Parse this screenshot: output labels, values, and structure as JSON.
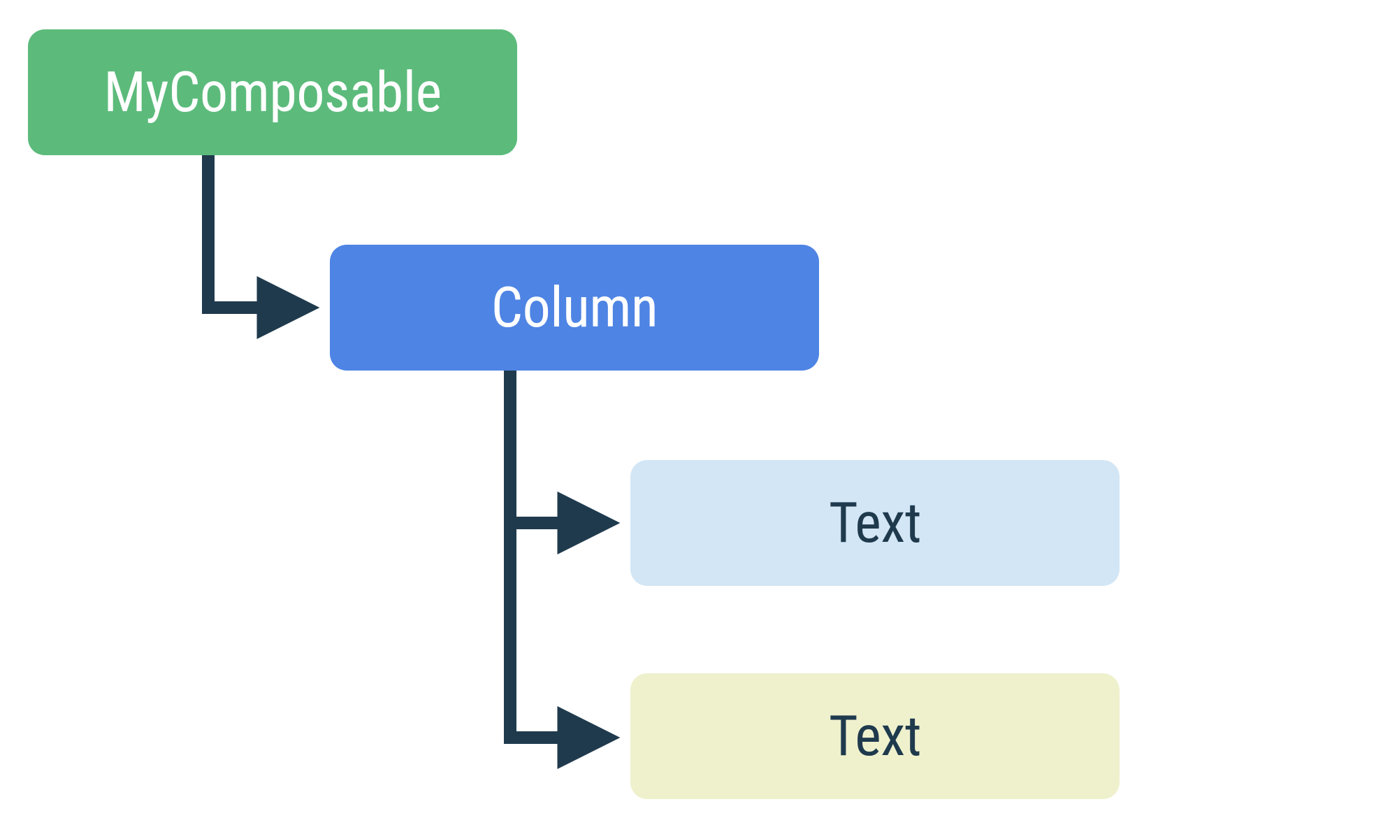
{
  "diagram": {
    "nodes": {
      "root": {
        "label": "MyComposable",
        "bg": "#5cbb7b",
        "fg": "#ffffff"
      },
      "column": {
        "label": "Column",
        "bg": "#4e84e4",
        "fg": "#ffffff"
      },
      "text1": {
        "label": "Text",
        "bg": "#d3e6f5",
        "fg": "#1f3a4d"
      },
      "text2": {
        "label": "Text",
        "bg": "#eff1cd",
        "fg": "#1f3a4d"
      }
    },
    "colors": {
      "arrow": "#1f3a4d"
    },
    "edges": [
      {
        "from": "root",
        "to": "column"
      },
      {
        "from": "column",
        "to": "text1"
      },
      {
        "from": "column",
        "to": "text2"
      }
    ]
  }
}
